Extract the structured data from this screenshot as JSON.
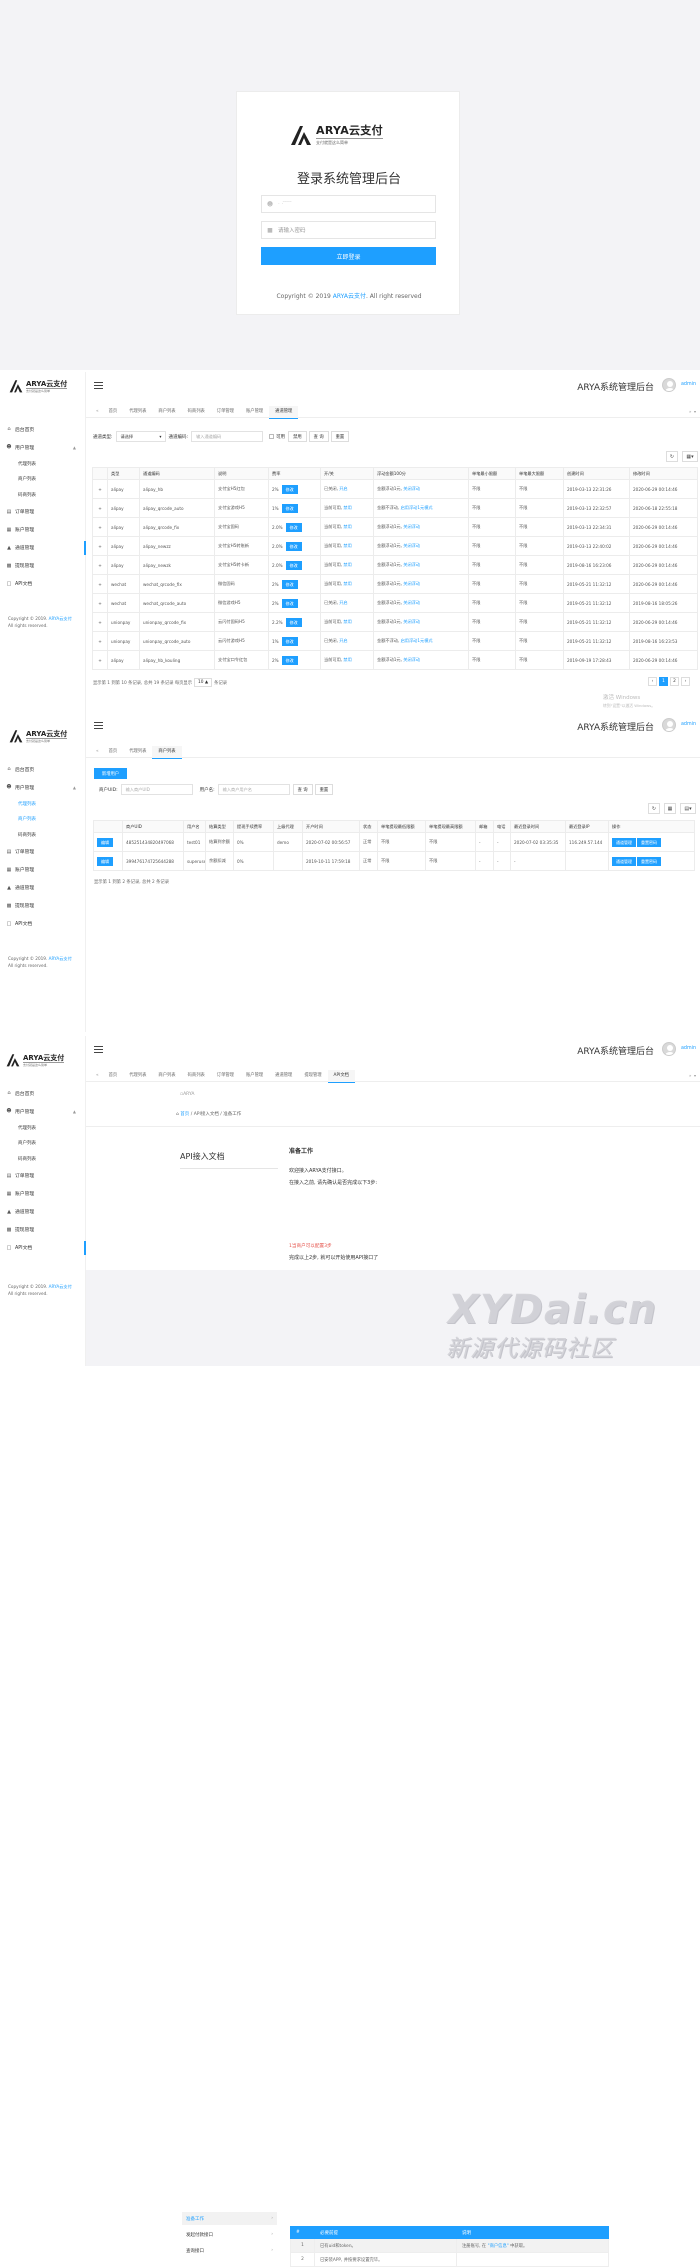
{
  "brand": {
    "logo_main": "ARYA云支付",
    "logo_sub": "支付就是这么简单",
    "side_sub": "支付就是这么简单"
  },
  "login": {
    "title": "登录系统管理后台",
    "username_value": "· ·  ̄ ̄ ̄ ̄ ̄  ",
    "password_placeholder": "请输入密码",
    "submit": "立即登录",
    "copyright_prefix": "Copyright © 2019 ",
    "copyright_link": "ARYA云支付",
    "copyright_suffix": ". All right reserved"
  },
  "header": {
    "system_title": "ARYA系统管理后台",
    "username": "admin"
  },
  "sidebar": {
    "items": {
      "home": "后台首页",
      "user_mgmt": "用户管理",
      "agent_list": "代理列表",
      "merchant_list": "商户列表",
      "code_merchant_list": "码商列表",
      "orders": "订单管理",
      "accounts": "账户管理",
      "channels": "通道管理",
      "withdraw": "提现管理",
      "api_doc": "API文档"
    },
    "copyright": "Copyright © 2019. ",
    "copyright_link": "ARYA云支付",
    "copyright_tail": "All rights reserved."
  },
  "tabs": {
    "home": "首页",
    "agent": "代理列表",
    "merchant": "商户列表",
    "code_merchant": "码商列表",
    "order": "订单管理",
    "account": "账户管理",
    "channel": "通道管理",
    "withdraw": "提现管理",
    "api": "API文档"
  },
  "channels": {
    "filter": {
      "type_label": "通道类型:",
      "type_value": "请选择",
      "code_label": "通道编码:",
      "code_placeholder": "输入通道编码",
      "enabled": "可用",
      "disabled": "禁用",
      "search": "查 询",
      "reset": "重置"
    },
    "columns": [
      "",
      "类型",
      "通道编码",
      "说明",
      "费率",
      "开/关",
      "浮动金额100分",
      "单笔最小限额",
      "单笔最大限额",
      "创建时间",
      "修改时间"
    ],
    "edit_label": "修改",
    "rows": [
      {
        "type": "alipay",
        "code": "alipay_hb",
        "desc": "支付宝H5红包",
        "rate": "2%",
        "state": "已关闭,",
        "state_link": "开启",
        "float": "金额浮动1元,",
        "float_link": "关闭浮动",
        "min": "不限",
        "max": "不限",
        "created": "2019-03-13 22:31:26",
        "updated": "2020-06-29 00:14:46"
      },
      {
        "type": "alipay",
        "code": "alipay_qrcode_auto",
        "desc": "支付宝游戏H5",
        "rate": "1%",
        "state": "当前可用,",
        "state_link": "禁用",
        "float": "金额不浮动,",
        "float_link": "启用浮动1元模式",
        "min": "不限",
        "max": "不限",
        "created": "2019-03-13 22:32:57",
        "updated": "2020-06-18 22:55:18"
      },
      {
        "type": "alipay",
        "code": "alipay_qrcode_fix",
        "desc": "支付宝固码",
        "rate": "2.0%",
        "state": "当前可用,",
        "state_link": "禁用",
        "float": "金额浮动1元,",
        "float_link": "关闭浮动",
        "min": "不限",
        "max": "不限",
        "created": "2019-03-13 22:34:31",
        "updated": "2020-06-29 00:14:46"
      },
      {
        "type": "alipay",
        "code": "alipay_newzz",
        "desc": "支付宝H5转账新",
        "rate": "2.0%",
        "state": "当前可用,",
        "state_link": "禁用",
        "float": "金额浮动1元,",
        "float_link": "关闭浮动",
        "min": "不限",
        "max": "不限",
        "created": "2019-03-13 22:40:02",
        "updated": "2020-06-29 00:14:46"
      },
      {
        "type": "alipay",
        "code": "alipay_newzk",
        "desc": "支付宝H5转卡新",
        "rate": "2.0%",
        "state": "当前可用,",
        "state_link": "禁用",
        "float": "金额浮动1元,",
        "float_link": "关闭浮动",
        "min": "不限",
        "max": "不限",
        "created": "2019-08-16 16:23:06",
        "updated": "2020-06-29 00:14:46"
      },
      {
        "type": "wechat",
        "code": "wechat_qrcode_fix",
        "desc": "微信固码",
        "rate": "2%",
        "state": "当前可用,",
        "state_link": "禁用",
        "float": "金额浮动1元,",
        "float_link": "关闭浮动",
        "min": "不限",
        "max": "不限",
        "created": "2019-05-21 11:32:12",
        "updated": "2020-06-29 00:14:46"
      },
      {
        "type": "wechat",
        "code": "wechat_qrcode_auto",
        "desc": "微信游戏H5",
        "rate": "2%",
        "state": "已关闭,",
        "state_link": "开启",
        "float": "金额浮动1元,",
        "float_link": "关闭浮动",
        "min": "不限",
        "max": "不限",
        "created": "2019-05-21 11:32:12",
        "updated": "2019-08-16 18:05:26"
      },
      {
        "type": "unionpay",
        "code": "unionpay_qrcode_fix",
        "desc": "云闪付固码H5",
        "rate": "2.2%",
        "state": "当前可用,",
        "state_link": "禁用",
        "float": "金额浮动1元,",
        "float_link": "关闭浮动",
        "min": "不限",
        "max": "不限",
        "created": "2019-05-21 11:32:12",
        "updated": "2020-06-29 00:14:46"
      },
      {
        "type": "unionpay",
        "code": "unionpay_qrcode_auto",
        "desc": "云闪付游戏H5",
        "rate": "1%",
        "state": "已关闭,",
        "state_link": "开启",
        "float": "金额不浮动,",
        "float_link": "启用浮动1元模式",
        "min": "不限",
        "max": "不限",
        "created": "2019-05-21 11:32:12",
        "updated": "2019-08-16 16:23:53"
      },
      {
        "type": "alipay",
        "code": "alipay_hb_kouling",
        "desc": "支付宝口令红包",
        "rate": "2%",
        "state": "当前可用,",
        "state_link": "禁用",
        "float": "金额浮动1元,",
        "float_link": "关闭浮动",
        "min": "不限",
        "max": "不限",
        "created": "2019-09-19 17:28:43",
        "updated": "2020-06-29 00:14:46"
      }
    ],
    "pager": {
      "info": "显示第 1 到第 10 条记录, 总共 19 条记录 每页显示",
      "size": "10 ▲",
      "tail": "条记录",
      "pages": [
        "‹",
        "1",
        "2",
        "›"
      ]
    }
  },
  "merchants": {
    "add_button": "新增用户",
    "filter": {
      "uid_label": "商户UID:",
      "uid_placeholder": "输入商户UID",
      "name_label": "用户名:",
      "name_placeholder": "输入商户用户名",
      "search": "查 询",
      "reset": "重置"
    },
    "columns": [
      "",
      "商户UID",
      "用户名",
      "结算类型",
      "提现手续费率",
      "上级代理",
      "开户时间",
      "状态",
      "单笔提现最低限额",
      "单笔提现最高限额",
      "邮箱",
      "电话",
      "最近登录时间",
      "最近登录IP",
      "操作"
    ],
    "edit_label": "编辑",
    "channel_btn": "通道管理",
    "reset_pwd_btn": "重置密码",
    "rows": [
      {
        "uid": "485251434820497068",
        "name": "test01",
        "settle": "结算到余额",
        "fee": "0%",
        "agent": "demo",
        "opened": "2020-07-02 00:56:57",
        "status": "正常",
        "min": "不限",
        "max": "不限",
        "email": "-",
        "phone": "-",
        "last_login": "2020-07-02 03:35:35",
        "last_ip": "116.249.57.144"
      },
      {
        "uid": "399476174725644288",
        "name": "superuser",
        "settle": "余额扣减",
        "fee": "0%",
        "agent": "",
        "opened": "2019-10-11 17:59:18",
        "status": "正常",
        "min": "不限",
        "max": "不限",
        "email": "-",
        "phone": "-",
        "last_login": "-",
        "last_ip": ""
      }
    ],
    "pager_info": "显示第 1 到第 2 条记录, 总共 2 条记录"
  },
  "doc": {
    "breadcrumb_home": "首页",
    "breadcrumb_sep1": "/",
    "breadcrumb_mid": "API接入文档",
    "breadcrumb_sep2": "/",
    "breadcrumb_cur": "准备工作",
    "banner_alt": "ARYA",
    "side_title": "API接入文档",
    "links": [
      "准备工作",
      "发起付款接口",
      "查询接口"
    ],
    "heading": "准备工作",
    "intro1": "欢迎接入ARYA支付接口。",
    "intro2": "在接入之前, 请先确认是否完成以下3步:",
    "table_columns": [
      "#",
      "必要前提",
      "说明"
    ],
    "table_rows": [
      {
        "n": "1",
        "req": "已有uid和token。",
        "note_prefix": "注册账号, 在 ",
        "note_link": "\"商户信息\"",
        "note_suffix": " 中获取。"
      },
      {
        "n": "2",
        "req": "已安装APP, 并按要求设置完毕。",
        "note_prefix": "",
        "note_link": "",
        "note_suffix": ""
      }
    ],
    "note_red": "1当商户可以配置3步",
    "finish": "完成以上2步, 就可以开始使用API接口了"
  },
  "watermarks": {
    "win_title": "激活 Windows",
    "win_sub": "转到\"设置\"以激活 Windows。",
    "site": "XYDai.cn",
    "site_cn": "新源代源码社区"
  },
  "colors": {
    "accent": "#1e9fff",
    "bg": "#f3f3f6"
  }
}
